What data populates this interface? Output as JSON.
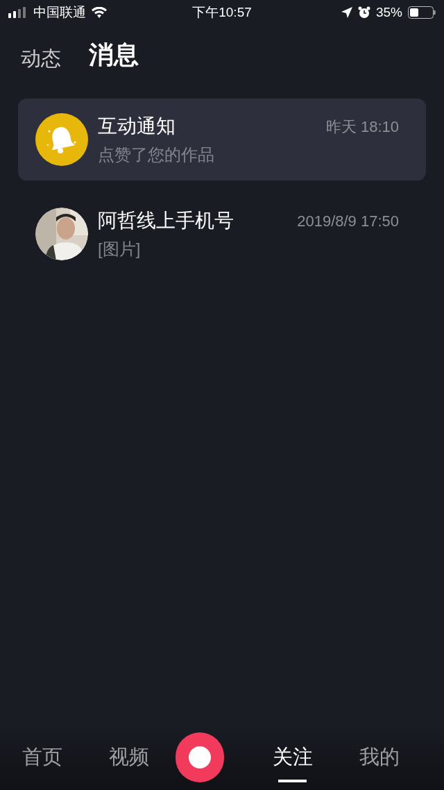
{
  "status_bar": {
    "carrier": "中国联通",
    "time": "下午10:57",
    "battery": "35%"
  },
  "header_tabs": [
    {
      "label": "动态",
      "selected": false
    },
    {
      "label": "消息",
      "selected": true
    }
  ],
  "messages": [
    {
      "kind": "notification",
      "title": "互动通知",
      "time": "昨天 18:10",
      "preview": "点赞了您的作品",
      "highlighted": true
    },
    {
      "kind": "chat",
      "title": "阿哲线上手机号",
      "time": "2019/8/9 17:50",
      "preview": "[图片]",
      "highlighted": false
    }
  ],
  "bottom_nav": [
    {
      "kind": "tab",
      "label": "首页",
      "selected": false
    },
    {
      "kind": "tab",
      "label": "视频",
      "selected": false
    },
    {
      "kind": "record"
    },
    {
      "kind": "tab",
      "label": "关注",
      "selected": true
    },
    {
      "kind": "tab",
      "label": "我的",
      "selected": false
    }
  ]
}
